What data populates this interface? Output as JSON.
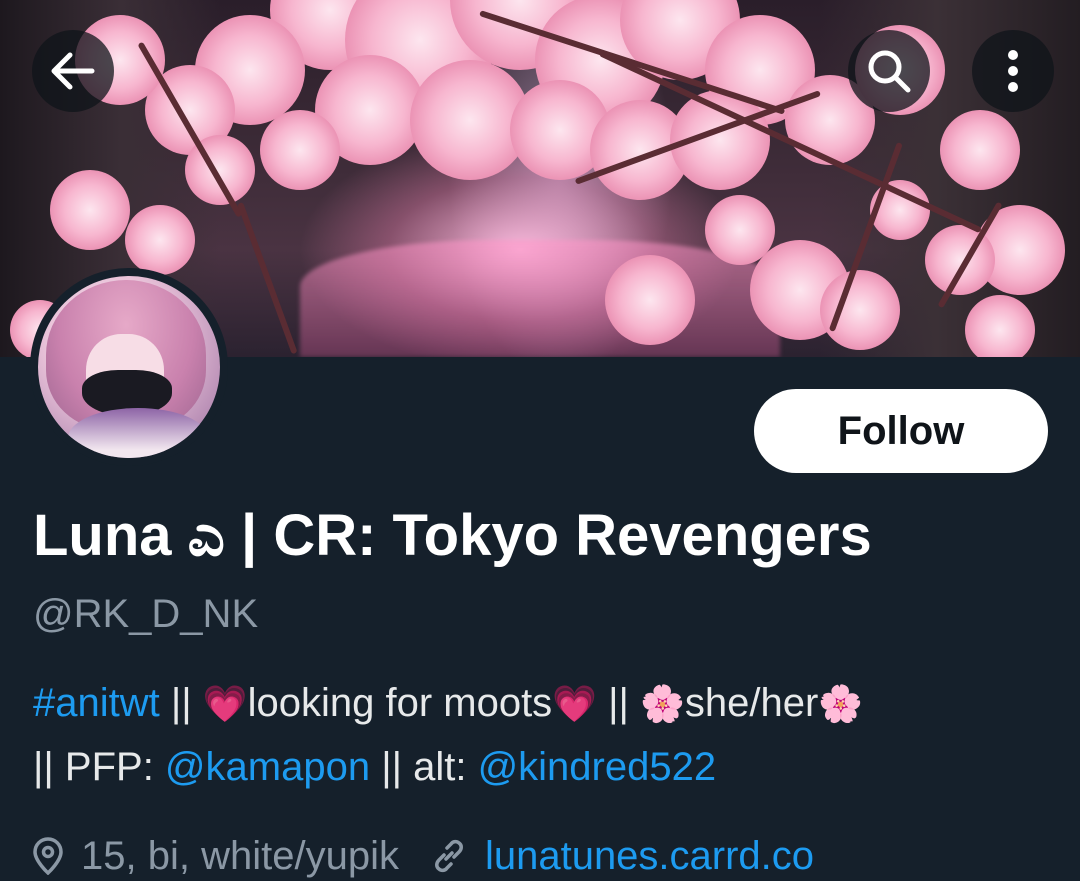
{
  "header": {
    "back_icon": "arrow-left-icon",
    "search_icon": "search-icon",
    "more_icon": "more-vertical-icon"
  },
  "profile": {
    "display_name": "Luna ಎ | CR: Tokyo Revengers",
    "handle": "@RK_D_NK",
    "follow_label": "Follow",
    "bio": {
      "line1": [
        {
          "text": "#anitwt",
          "type": "link"
        },
        {
          "text": " || ",
          "type": "text"
        },
        {
          "text": "💗",
          "type": "emoji"
        },
        {
          "text": "looking for moots",
          "type": "text"
        },
        {
          "text": "💗",
          "type": "emoji"
        },
        {
          "text": " || ",
          "type": "text"
        },
        {
          "text": "🌸",
          "type": "emoji"
        },
        {
          "text": "she/her",
          "type": "text"
        },
        {
          "text": "🌸",
          "type": "emoji"
        }
      ],
      "line2": [
        {
          "text": "|| PFP: ",
          "type": "text"
        },
        {
          "text": "@kamapon",
          "type": "link"
        },
        {
          "text": " || alt: ",
          "type": "text"
        },
        {
          "text": "@kindred522",
          "type": "link"
        }
      ]
    },
    "location": "15, bi, white/yupik",
    "website": "lunatunes.carrd.co",
    "location_icon": "location-pin-icon",
    "website_icon": "link-icon"
  },
  "colors": {
    "background": "#15202b",
    "link": "#1d9bf0",
    "secondary_text": "#8b98a5",
    "primary_text": "#ffffff",
    "follow_bg": "#ffffff",
    "follow_text": "#0f1419"
  }
}
